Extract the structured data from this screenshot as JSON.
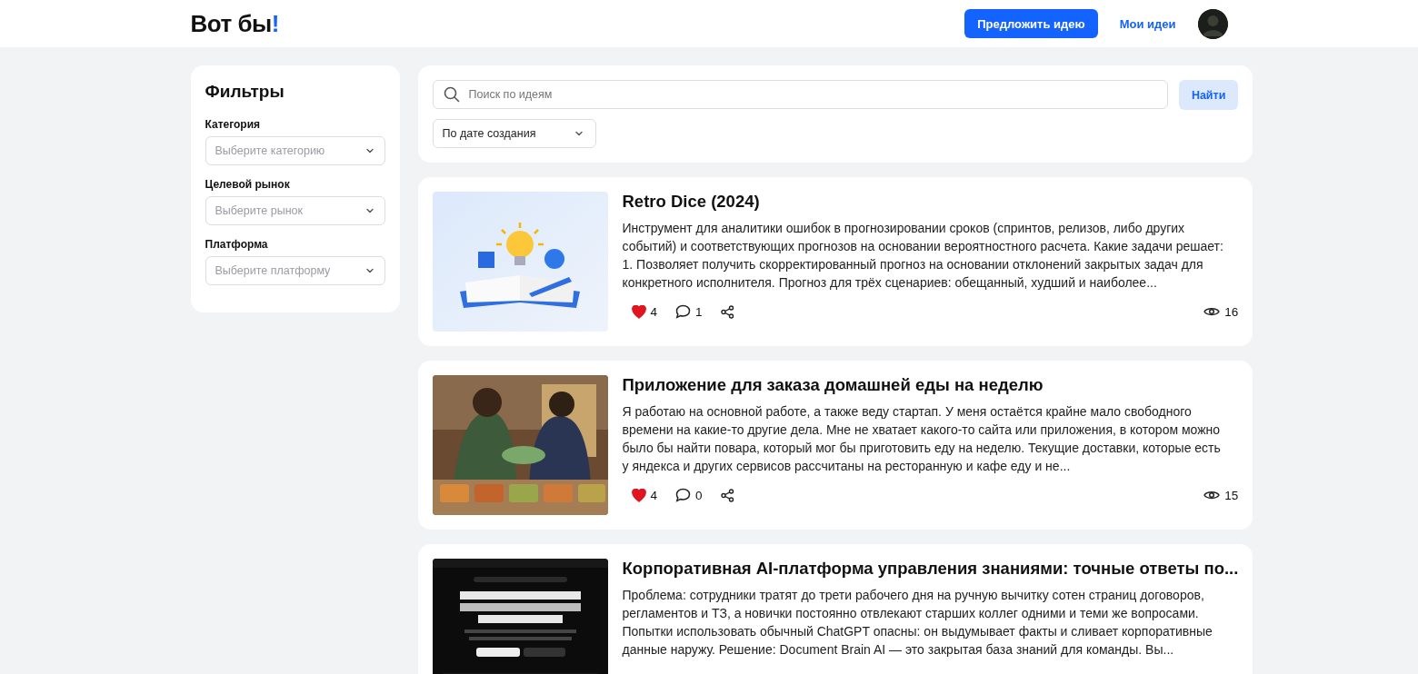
{
  "header": {
    "logo": "Вот бы",
    "logo_mark": "!",
    "suggest_button": "Предложить идею",
    "my_ideas_link": "Мои идеи"
  },
  "filters": {
    "title": "Фильтры",
    "groups": [
      {
        "label": "Категория",
        "placeholder": "Выберите категорию"
      },
      {
        "label": "Целевой рынок",
        "placeholder": "Выберите рынок"
      },
      {
        "label": "Платформа",
        "placeholder": "Выберите платформу"
      }
    ]
  },
  "search": {
    "placeholder": "Поиск по идеям",
    "button": "Найти",
    "sort": "По дате создания"
  },
  "ideas": [
    {
      "kind": "picture",
      "title": "Retro Dice (2024)",
      "text": "Инструмент для аналитики ошибок в прогнозировании сроков (спринтов, релизов, либо других событий) и соответствующих прогнозов на основании вероятностного расчета. Какие задачи решает: 1. Позволяет получить скорректированный прогноз на основании отклонений закрытых задач для конкретного исполнителя. Прогноз для трёх сценариев: обещанный, худший и наиболее...",
      "liked": true,
      "likes": "4",
      "comments": "1",
      "views": "16"
    },
    {
      "kind": "picture",
      "title": "Приложение для заказа домашней еды на неделю",
      "text": "Я работаю на основной работе, а также веду стартап. У меня остаётся крайне мало свободного времени на какие-то другие дела. Мне не хватает какого-то сайта или приложения, в котором можно было бы найти повара, который мог бы приготовить еду на неделю. Текущие доставки, которые есть у яндекса и других сервисов рассчитаны на ресторанную и кафе еду и не...",
      "liked": true,
      "likes": "4",
      "comments": "0",
      "views": "15"
    },
    {
      "kind": "picture",
      "title": "Корпоративная AI-платформа управления знаниями: точные ответы по...",
      "text": "Проблема: сотрудники тратят до трети рабочего дня на ручную вычитку сотен страниц договоров, регламентов и ТЗ, а новички постоянно отвлекают старших коллег одними и теми же вопросами. Попытки использовать обычный ChatGPT опасны: он выдумывает факты и сливает корпоративные данные наружу. Решение: Document Brain AI — это закрытая база знаний для команды. Вы..."
    }
  ]
}
